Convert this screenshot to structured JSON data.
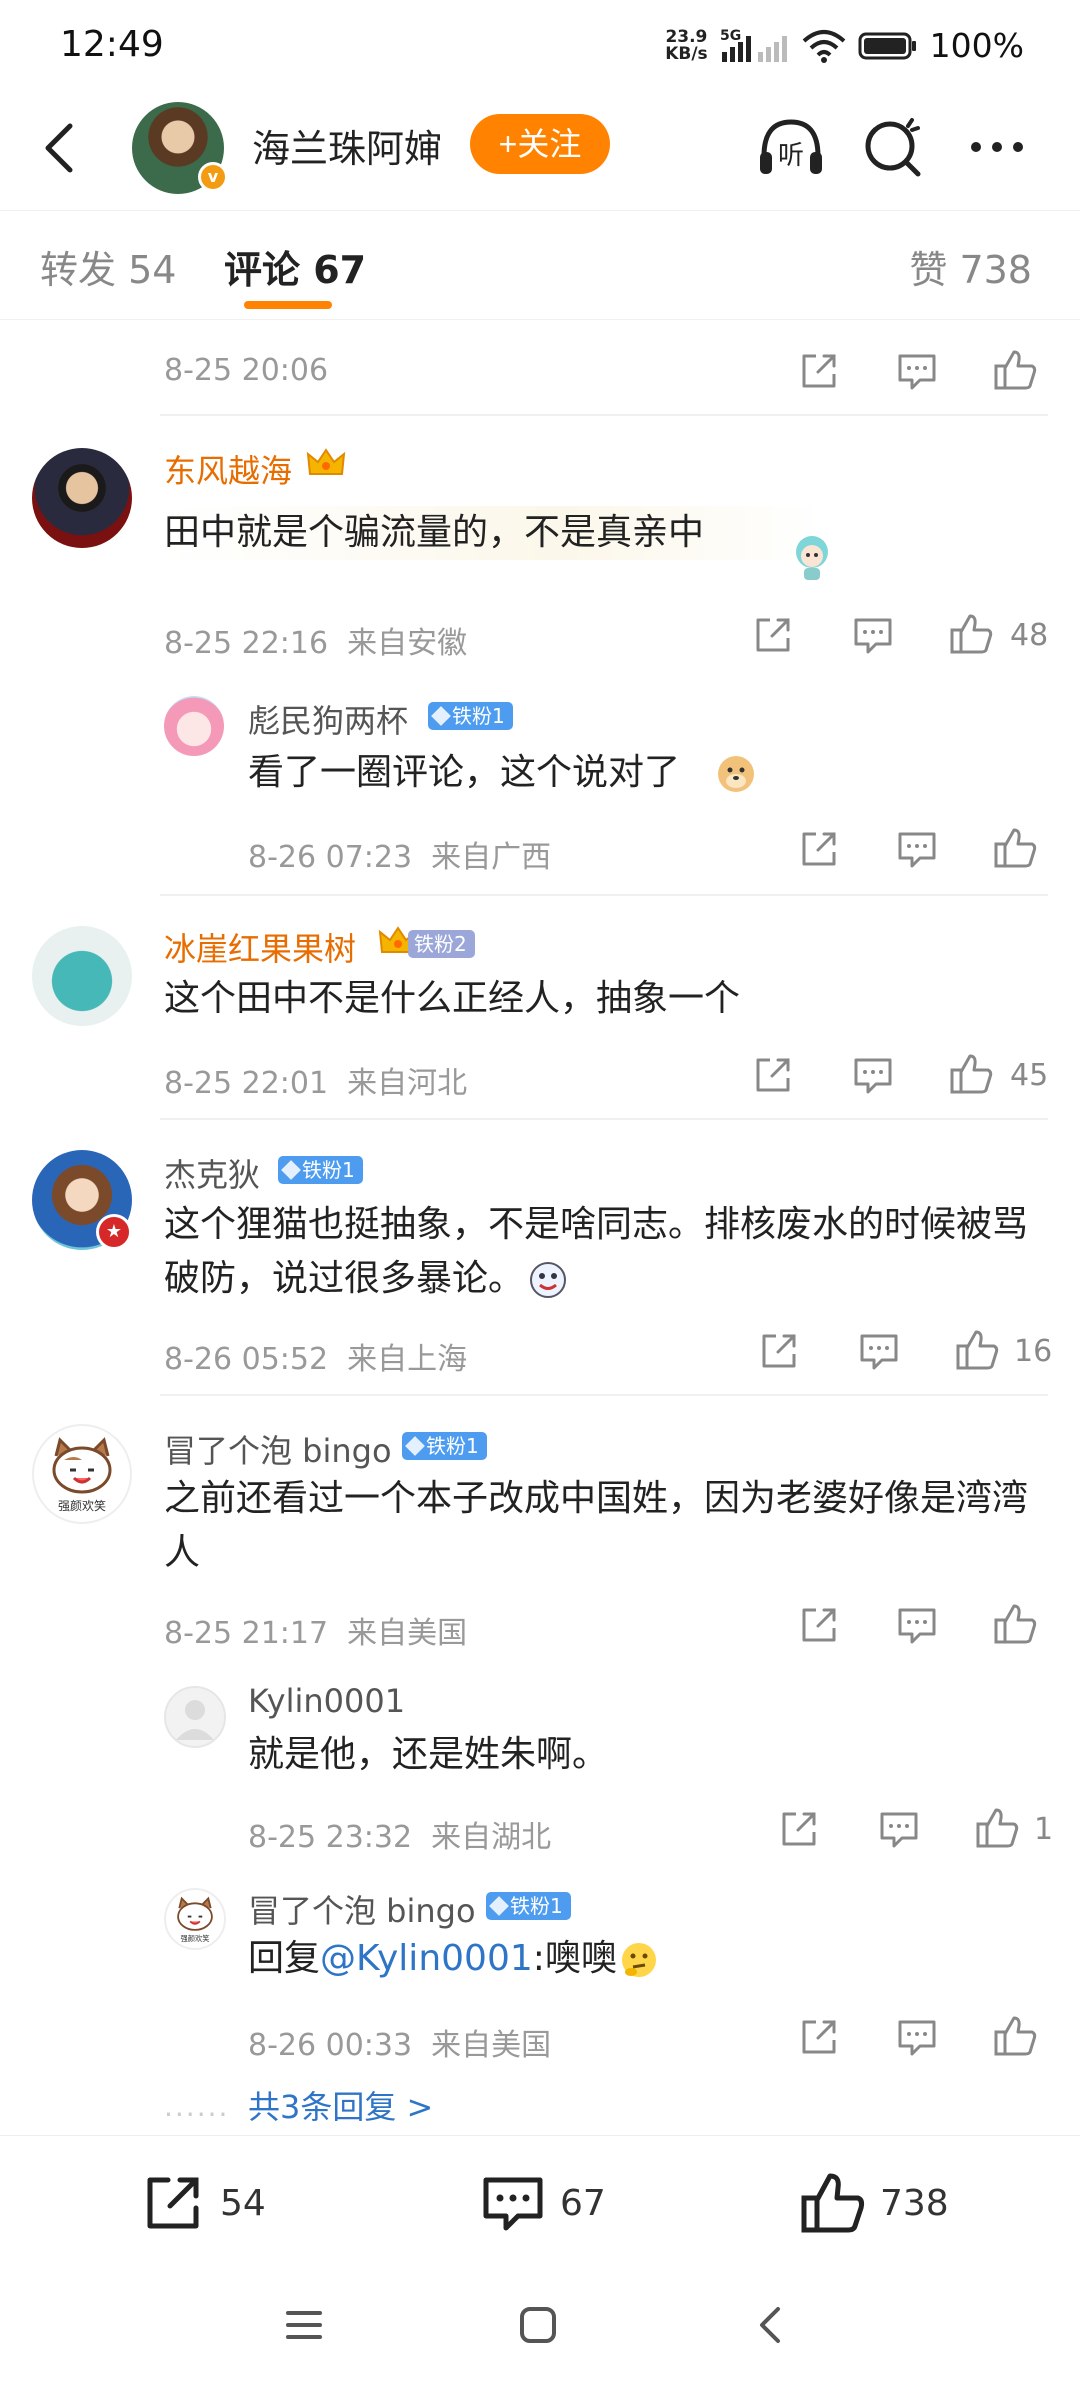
{
  "status_bar": {
    "time": "12:49",
    "net_speed_value": "23.9",
    "net_speed_unit": "KB/s",
    "network": "5G",
    "battery": "100%"
  },
  "header": {
    "author_name": "海兰珠阿婶",
    "follow_label": "+关注",
    "listen_label": "听"
  },
  "tabs": {
    "repost": "转发 54",
    "comments": "评论 67",
    "likes": "赞 738"
  },
  "comments": [
    {
      "time": "8-25 20:06"
    },
    {
      "user": "东风越海",
      "text": "田中就是个骗流量的，不是真亲中",
      "time": "8-25 22:16",
      "location": "来自安徽",
      "likes": "48",
      "replies": [
        {
          "user": "彪民狗两杯",
          "badge": "铁粉1",
          "text": "看了一圈评论，这个说对了",
          "time": "8-26 07:23",
          "location": "来自广西"
        }
      ]
    },
    {
      "user": "冰崖红果果树",
      "badge": "铁粉2",
      "text": "这个田中不是什么正经人，抽象一个",
      "time": "8-25 22:01",
      "location": "来自河北",
      "likes": "45"
    },
    {
      "user": "杰克狄",
      "badge": "铁粉1",
      "text": "这个狸猫也挺抽象，不是啥同志。排核废水的时候被骂破防，说过很多暴论。",
      "time": "8-26 05:52",
      "location": "来自上海",
      "likes": "16"
    },
    {
      "user": "冒了个泡 bingo",
      "badge": "铁粉1",
      "avatar_text": "强颜欢笑",
      "text": "之前还看过一个本子改成中国姓，因为老婆好像是湾湾人",
      "time": "8-25 21:17",
      "location": "来自美国",
      "replies": [
        {
          "user": "Kylin0001",
          "text": "就是他，还是姓朱啊。",
          "time": "8-25 23:32",
          "location": "来自湖北",
          "likes": "1"
        },
        {
          "user": "冒了个泡 bingo",
          "badge": "铁粉1",
          "avatar_text": "强颜欢笑",
          "text_prefix": "回复",
          "mention": "@Kylin0001",
          "text_suffix": ":噢噢",
          "time": "8-26 00:33",
          "location": "来自美国"
        }
      ],
      "more_replies": "共3条回复 >"
    }
  ],
  "bottom_bar": {
    "reposts": "54",
    "comments": "67",
    "likes": "738"
  },
  "colors": {
    "accent": "#ff8200",
    "vip_name": "#e86d00",
    "link": "#2f75c7",
    "fan_badge": "#4d9cf0"
  },
  "icons": [
    "back-icon",
    "listen-icon",
    "search-icon",
    "more-icon",
    "share-icon",
    "comment-icon",
    "like-icon",
    "home-icon",
    "menu-icon",
    "nav-back-icon"
  ]
}
